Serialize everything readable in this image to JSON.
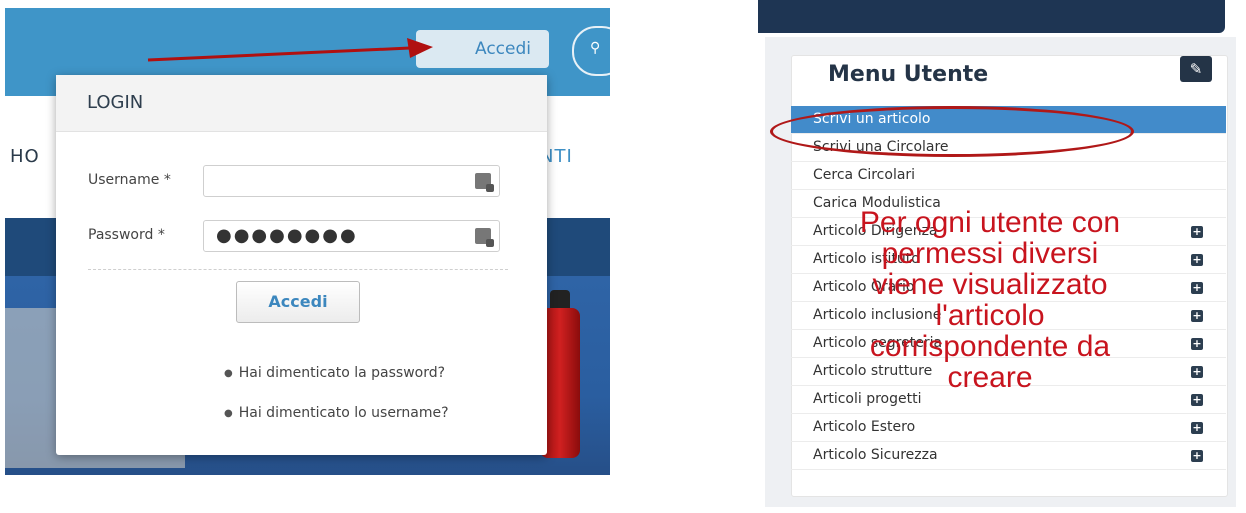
{
  "left": {
    "top_button_label": "Accedi",
    "nav_left": "HO",
    "nav_right": "NTI",
    "login": {
      "title": "LOGIN",
      "username_label": "Username *",
      "password_label": "Password *",
      "password_value": "●●●●●●●●",
      "button_label": "Accedi",
      "forgot_password": "Hai dimenticato la password?",
      "forgot_username": "Hai dimenticato lo username?"
    }
  },
  "right": {
    "menu_title": "Menu Utente",
    "items": [
      {
        "label": "Scrivi un articolo"
      },
      {
        "label": "Scrivi una Circolare"
      },
      {
        "label": "Cerca Circolari"
      },
      {
        "label": "Carica Modulistica"
      },
      {
        "label": "Articolo Dirigenza"
      },
      {
        "label": "Articolo istituto"
      },
      {
        "label": "Articolo Orario"
      },
      {
        "label": "Articolo inclusione"
      },
      {
        "label": "Articolo segreteria"
      },
      {
        "label": "Articolo strutture"
      },
      {
        "label": "Articoli progetti"
      },
      {
        "label": "Articolo Estero"
      },
      {
        "label": "Articolo Sicurezza"
      }
    ],
    "annotation_lines": [
      "Per ogni utente con",
      "permessi diversi",
      "viene visualizzato",
      "l'articolo",
      "corrispondente da",
      "creare"
    ]
  },
  "icons": {
    "search": "search-icon",
    "key": "key-icon",
    "edit": "edit-icon",
    "plus": "plus-icon"
  },
  "colors": {
    "header_blue": "#3f95c8",
    "dark_blue": "#1f4a7a",
    "active_row": "#428bca",
    "annotation_red": "#c8141e"
  }
}
